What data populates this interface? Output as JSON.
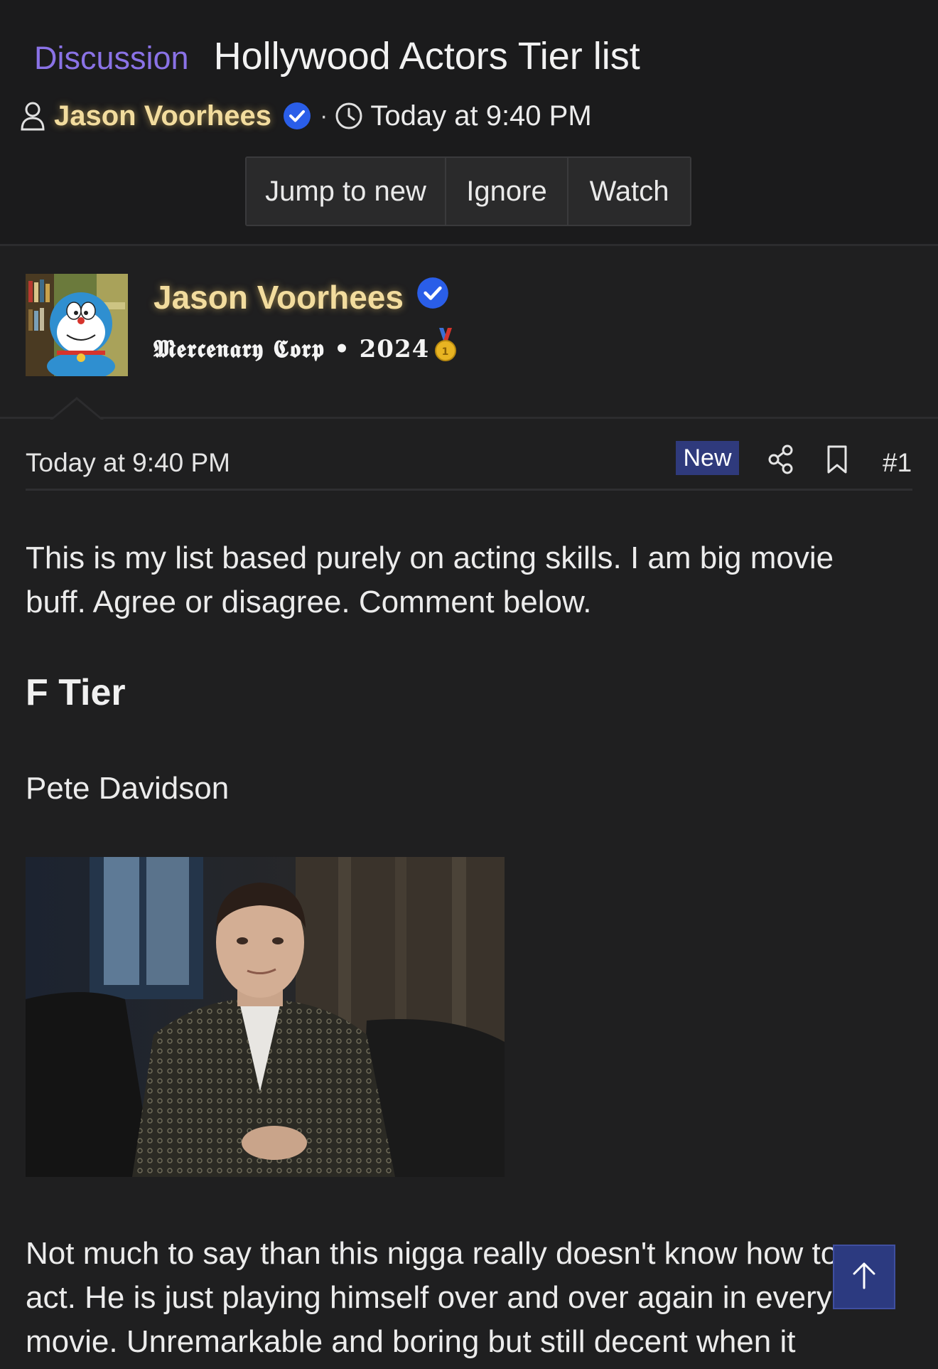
{
  "thread": {
    "prefix": "Discussion",
    "title": "Hollywood Actors Tier list",
    "author": "Jason Voorhees",
    "separator": "·",
    "time": "Today at 9:40 PM"
  },
  "actions": {
    "jump_label": "Jump to new",
    "ignore_label": "Ignore",
    "watch_label": "Watch"
  },
  "author_card": {
    "name": "Jason Voorhees",
    "title": "𝕸𝖊𝖗𝖈𝖊𝖓𝖆𝖗𝖞 𝕮𝖔𝖗𝖕 • 2024",
    "avatar_icon": "doraemon-avatar",
    "medal_icon": "gold-medal-icon"
  },
  "post": {
    "date": "Today at 9:40 PM",
    "badge": "New",
    "number": "#1",
    "intro": "This is my list based purely on acting skills. I am big movie buff. Agree or disagree. Comment below.",
    "tier_heading": "F Tier",
    "actor": "Pete Davidson",
    "comment": "Not much to say than this nigga really doesn't know how to act. He is just playing himself over and over again in every movie. Unremarkable and boring but still decent when it"
  },
  "colors": {
    "prefix": "#8a72e6",
    "username": "#f2dc9e",
    "verified": "#2a5ee8",
    "badge_bg": "#2f3a7c",
    "background": "#1f1f20"
  }
}
